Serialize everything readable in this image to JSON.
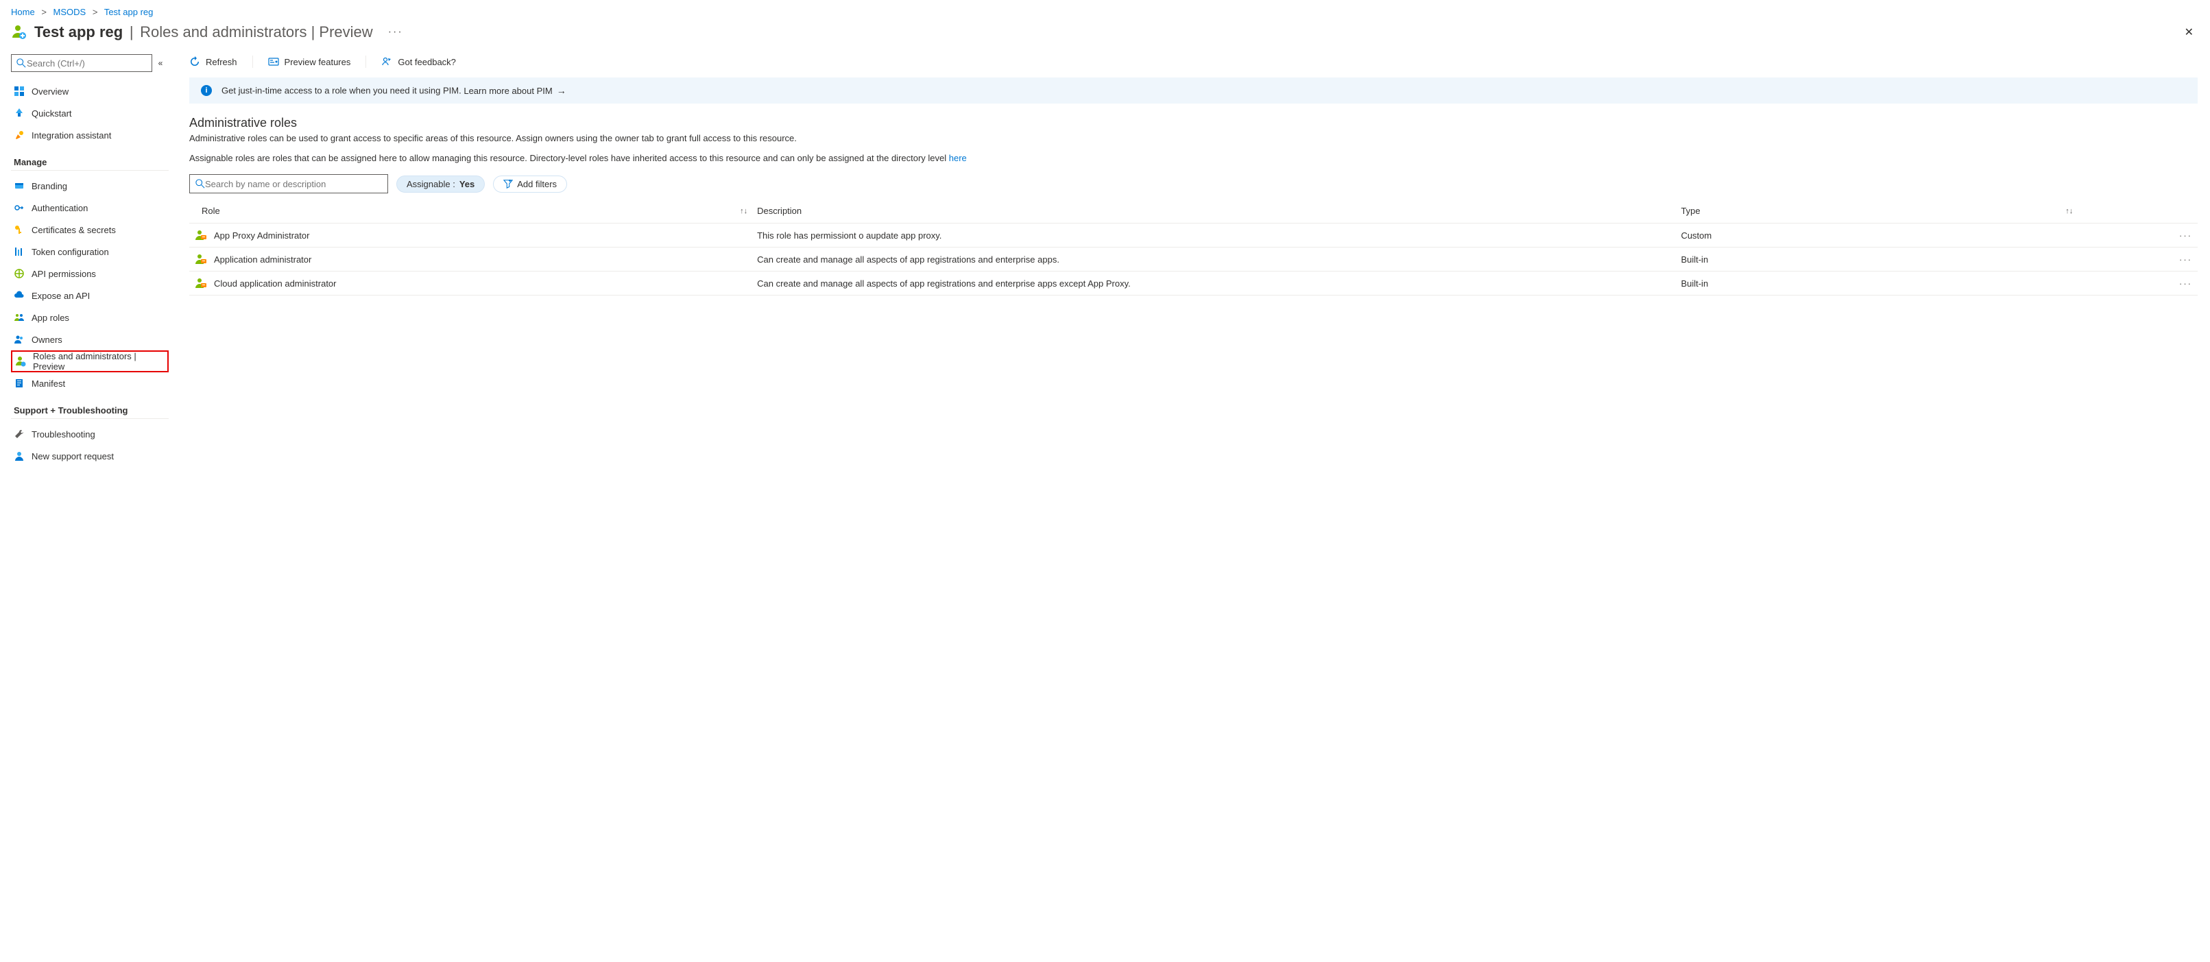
{
  "breadcrumbs": {
    "home": "Home",
    "msods": "MSODS",
    "current": "Test app reg"
  },
  "header": {
    "title": "Test app reg",
    "subtitle": "Roles and administrators | Preview"
  },
  "sidebar": {
    "search_placeholder": "Search (Ctrl+/)",
    "top_items": {
      "overview": "Overview",
      "quickstart": "Quickstart",
      "integration_assistant": "Integration assistant"
    },
    "section_manage": "Manage",
    "manage_items": {
      "branding": "Branding",
      "authentication": "Authentication",
      "certificates_secrets": "Certificates & secrets",
      "token_configuration": "Token configuration",
      "api_permissions": "API permissions",
      "expose_api": "Expose an API",
      "app_roles": "App roles",
      "owners": "Owners",
      "roles_admins": "Roles and administrators | Preview",
      "manifest": "Manifest"
    },
    "section_support": "Support + Troubleshooting",
    "support_items": {
      "troubleshooting": "Troubleshooting",
      "new_support_request": "New support request"
    }
  },
  "toolbar": {
    "refresh": "Refresh",
    "preview_features": "Preview features",
    "got_feedback": "Got feedback?"
  },
  "banner": {
    "prefix": "Get just-in-time access to a role when you need it using PIM. ",
    "link_text": "Learn more about PIM"
  },
  "section": {
    "title": "Administrative roles",
    "desc1": "Administrative roles can be used to grant access to specific areas of this resource. Assign owners using the owner tab to grant full access to this resource.",
    "desc2_a": "Assignable roles are roles that can be assigned here to allow managing this resource. Directory-level roles have inherited access to this resource and can only be assigned at the directory level ",
    "desc2_link": "here"
  },
  "filters": {
    "search_placeholder": "Search by name or description",
    "assignable_label": "Assignable : ",
    "assignable_value": "Yes",
    "add_filters": "Add filters"
  },
  "table": {
    "col_role": "Role",
    "col_description": "Description",
    "col_type": "Type",
    "rows": [
      {
        "role": "App Proxy Administrator",
        "description": "This role has permissiont o aupdate app proxy.",
        "type": "Custom"
      },
      {
        "role": "Application administrator",
        "description": "Can create and manage all aspects of app registrations and enterprise apps.",
        "type": "Built-in"
      },
      {
        "role": "Cloud application administrator",
        "description": "Can create and manage all aspects of app registrations and enterprise apps except App Proxy.",
        "type": "Built-in"
      }
    ]
  }
}
